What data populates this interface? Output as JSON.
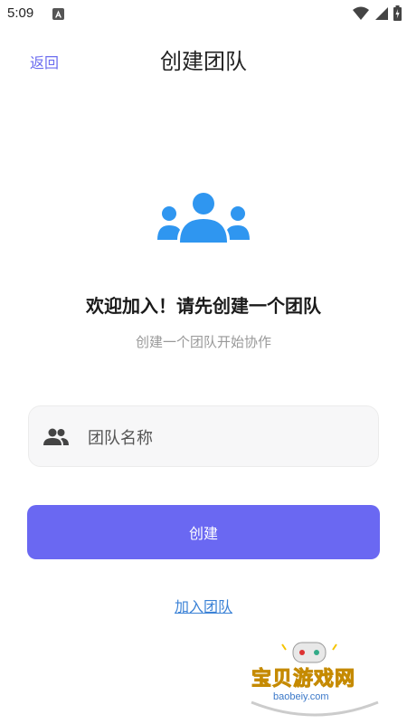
{
  "status_bar": {
    "time": "5:09"
  },
  "header": {
    "back_label": "返回",
    "title": "创建团队"
  },
  "main": {
    "heading": "欢迎加入！请先创建一个团队",
    "subtitle": "创建一个团队开始协作",
    "team_name_placeholder": "团队名称",
    "create_label": "创建",
    "join_label": "加入团队"
  },
  "watermark": {
    "text": "宝贝游戏网",
    "url": "baobeiy.com"
  },
  "colors": {
    "accent": "#6a68f2",
    "link": "#3b82d6",
    "icon_blue": "#2f96f0"
  },
  "icons": [
    "team-icon",
    "people-icon",
    "wifi-icon",
    "signal-icon",
    "battery-icon"
  ]
}
